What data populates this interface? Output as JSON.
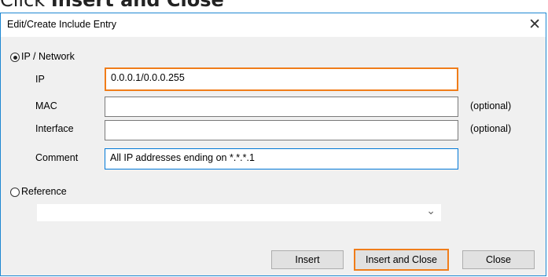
{
  "banner": {
    "prefix": "Click ",
    "emphasis": "Insert and Close"
  },
  "window": {
    "title": "Edit/Create Include Entry",
    "close_glyph": "✕"
  },
  "ip_network": {
    "radio_label": "IP / Network",
    "selected": true,
    "ip": {
      "label": "IP",
      "value": "0.0.0.1/0.0.0.255"
    },
    "mac": {
      "label": "MAC",
      "value": "",
      "hint": "(optional)"
    },
    "interface": {
      "label": "Interface",
      "value": "",
      "hint": "(optional)"
    },
    "comment": {
      "label": "Comment",
      "value": "All IP addresses ending on  *.*.*.1"
    }
  },
  "reference": {
    "radio_label": "Reference",
    "selected": false,
    "value": "",
    "chevron_icon": "chevron-down-icon"
  },
  "buttons": {
    "insert": "Insert",
    "insert_and_close": "Insert and Close",
    "close": "Close"
  },
  "colors": {
    "highlight": "#f07d1a",
    "focus": "#0078d7",
    "window_border": "#1e88d2"
  }
}
